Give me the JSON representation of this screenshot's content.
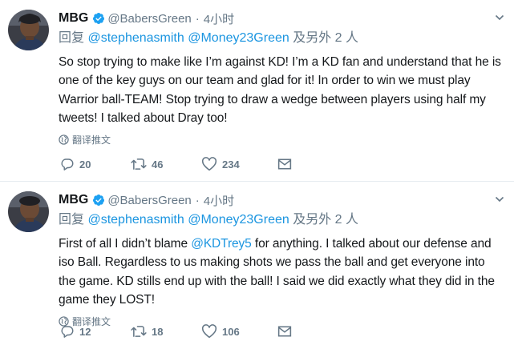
{
  "colors": {
    "accent": "#1b95e0",
    "muted": "#657786",
    "text": "#14171a",
    "verified": "#1da1f2"
  },
  "tweets": [
    {
      "name": "MBG",
      "handle": "@BabersGreen",
      "dot": "·",
      "time": "4小时",
      "reply_prefix": "回复",
      "reply_to": [
        "@stephenasmith",
        "@Money23Green"
      ],
      "reply_suffix": "及另外 2 人",
      "text_parts": [
        "So stop trying to make like I’m against KD! I’m a KD fan and understand that he is one of the key guys on our team and glad for it! In order to win we must play Warrior ball-TEAM! Stop trying to draw a wedge between players using  half my tweets! I talked about Dray too!"
      ],
      "translate": "翻译推文",
      "replies": "20",
      "retweets": "46",
      "likes": "234",
      "icons": [
        "verified-badge-icon",
        "chevron-down-icon",
        "globe-icon",
        "reply-icon",
        "retweet-icon",
        "heart-icon",
        "envelope-icon"
      ]
    },
    {
      "name": "MBG",
      "handle": "@BabersGreen",
      "dot": "·",
      "time": "4小时",
      "reply_prefix": "回复",
      "reply_to": [
        "@stephenasmith",
        "@Money23Green"
      ],
      "reply_suffix": "及另外 2 人",
      "text_before": "First of all I didn’t blame ",
      "text_mention": "@KDTrey5",
      "text_after": " for anything. I talked about our defense and iso Ball. Regardless to us making shots we pass the ball and get everyone into the game. KD stills end up with the ball! I said we did exactly what they did in the game they LOST!",
      "translate": "翻译推文",
      "replies": "12",
      "retweets": "18",
      "likes": "106"
    }
  ]
}
